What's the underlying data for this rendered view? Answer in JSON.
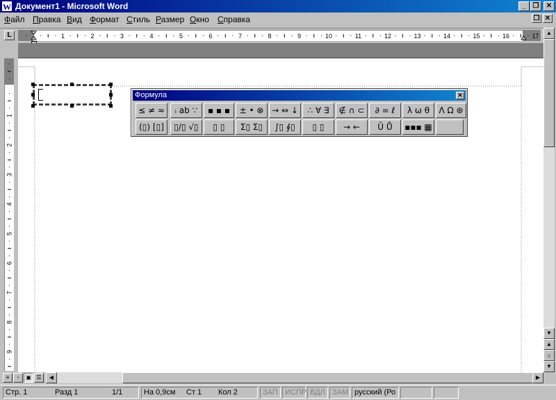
{
  "window": {
    "title": "Документ1 - Microsoft Word",
    "app_icon": "W"
  },
  "menu": [
    "Файл",
    "Правка",
    "Вид",
    "Формат",
    "Стиль",
    "Размер",
    "Окно",
    "Справка"
  ],
  "ruler": {
    "tab_selector": "L",
    "numbers": [
      "1",
      "2",
      "3",
      "4",
      "5",
      "6",
      "7",
      "8",
      "9",
      "10",
      "11",
      "12",
      "13",
      "14",
      "15",
      "16",
      "17"
    ],
    "vnumbers": [
      "1",
      "2",
      "3",
      "4",
      "5",
      "6",
      "7",
      "8",
      "9"
    ]
  },
  "formula_palette": {
    "title": "Формула",
    "row1": [
      "≤ ≠ ≈",
      "ᵢ ab ∵",
      "▪ ▪ ▪",
      "± • ⊗",
      "→ ⇔ ↓",
      "∴ ∀ ∃",
      "∉ ∩ ⊂",
      "∂ ∞ ℓ",
      "λ ω θ",
      "Λ Ω ⊛"
    ],
    "row2": [
      "(▯) [▯]",
      "▯/▯ √▯",
      "▯ ▯",
      "Σ▯ Σ▯",
      "∫▯ ∮▯",
      "▯ ▯",
      "→ ←",
      "Ū Ů",
      "▪▪▪ ▦",
      ""
    ]
  },
  "status": {
    "page": "Стр. 1",
    "section": "Разд 1",
    "pages": "1/1",
    "at": "На 0,9см",
    "line": "Ст 1",
    "col": "Кол 2",
    "rec": "ЗАП",
    "trk": "ИСПР",
    "ext": "ВДЛ",
    "ovr": "ЗАМ",
    "language": "русский (Ро"
  },
  "colors": {
    "title_start": "#000080",
    "title_end": "#1084d0",
    "face": "#c0c0c0",
    "page": "#ffffff"
  }
}
